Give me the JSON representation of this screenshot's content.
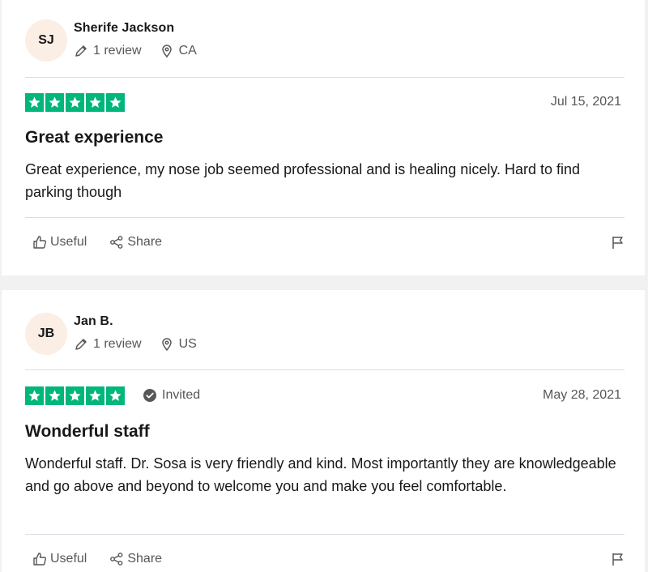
{
  "reviews": [
    {
      "initials": "SJ",
      "name": "Sherife Jackson",
      "review_count": "1 review",
      "location": "CA",
      "rating": 5,
      "invited": "",
      "date": "Jul 15, 2021",
      "title": "Great experience",
      "body": "Great experience, my nose job seemed professional and is healing nicely. Hard to find parking though",
      "useful_label": "Useful",
      "share_label": "Share"
    },
    {
      "initials": "JB",
      "name": "Jan B.",
      "review_count": "1 review",
      "location": "US",
      "rating": 5,
      "invited": "Invited",
      "date": "May 28, 2021",
      "title": "Wonderful staff",
      "body": "Wonderful staff. Dr. Sosa is very friendly and kind. Most importantly they are knowledgeable and go above and beyond to welcome you and make you feel comfortable.",
      "useful_label": "Useful",
      "share_label": "Share"
    }
  ],
  "colors": {
    "star_green": "#00b67a",
    "avatar_bg": "#fbeee5",
    "muted_text": "#575757"
  },
  "icons": {
    "review_count": "pencil-icon",
    "location": "location-pin-icon",
    "invited": "verified-check-icon",
    "useful": "thumbs-up-icon",
    "share": "share-icon",
    "report": "flag-icon"
  }
}
